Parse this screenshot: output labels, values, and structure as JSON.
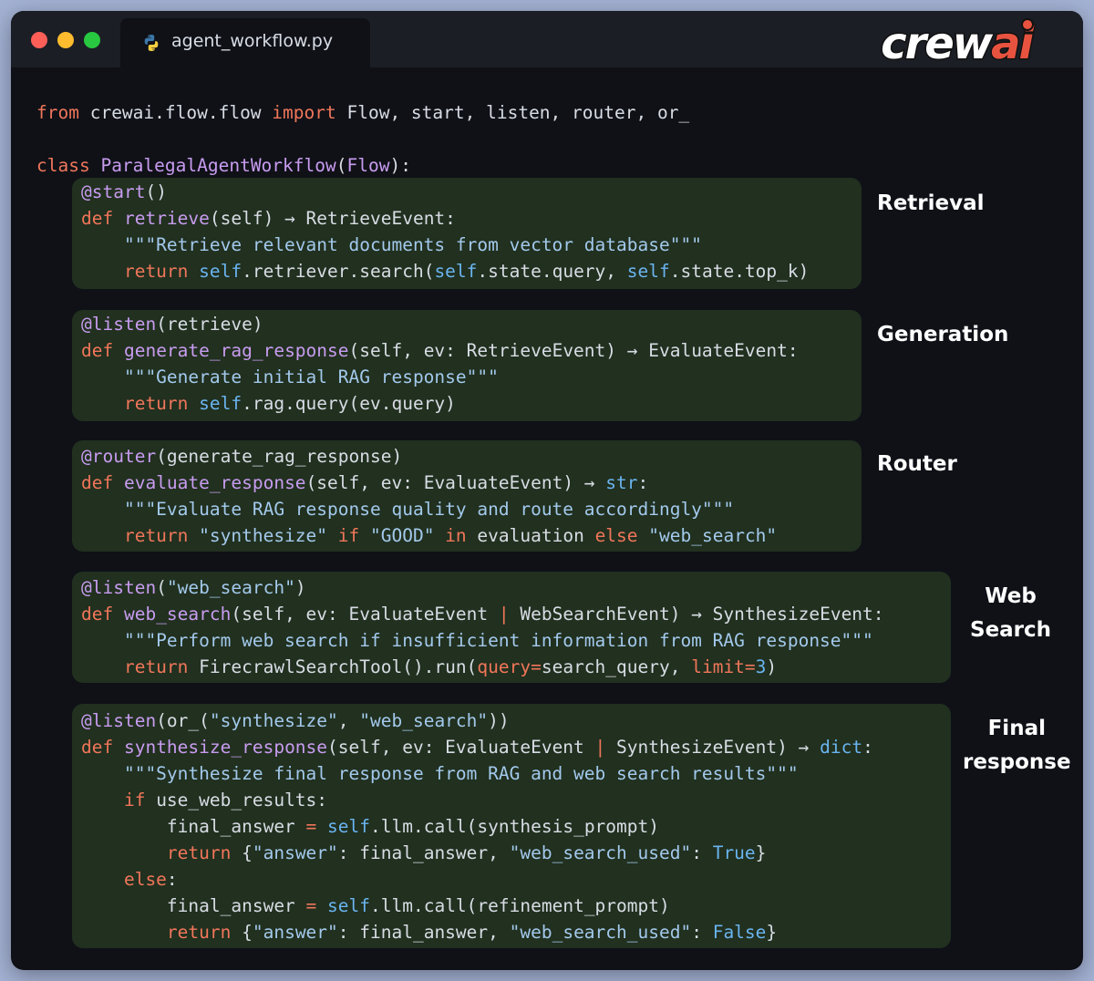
{
  "window": {
    "tab_label": "agent_workflow.py",
    "tab_icon": "python-icon",
    "logo_main": "crew",
    "logo_accent": "ai"
  },
  "colors": {
    "keyword": "#f0765a",
    "function": "#c89cf0",
    "string": "#a3c9ec",
    "self": "#6ab4f0",
    "text": "#d8dce4",
    "block_bg": "#21301f",
    "editor_bg": "#0f1117"
  },
  "code": {
    "import_line": {
      "t1": "from",
      "t2": " crewai.flow.flow ",
      "t3": "import",
      "t4": " Flow, start, listen, router, or_"
    },
    "class_line": {
      "t1": "class ",
      "t2": "ParalegalAgentWorkflow",
      "t3": "(",
      "t4": "Flow",
      "t5": "):"
    },
    "retrieve": {
      "l1": {
        "t1": "@start",
        "t2": "()"
      },
      "l2": {
        "t1": "def ",
        "t2": "retrieve",
        "t3": "(self) → RetrieveEvent:"
      },
      "l3": {
        "t1": "    \"\"\"Retrieve relevant documents from vector database\"\"\""
      },
      "l4": {
        "t1": "    return ",
        "t2": "self",
        ".t3": "",
        "t3": ".retriever.search(",
        "t4": "self",
        "t5": ".state.query, ",
        "t6": "self",
        "t7": ".state.top_k)"
      }
    },
    "generate": {
      "l1": {
        "t1": "@listen",
        "t2": "(retrieve)"
      },
      "l2": {
        "t1": "def ",
        "t2": "generate_rag_response",
        "t3": "(self, ev: RetrieveEvent) → EvaluateEvent:"
      },
      "l3": {
        "t1": "    \"\"\"Generate initial RAG response\"\"\""
      },
      "l4": {
        "t1": "    return ",
        "t2": "self",
        "t3": ".rag.query(ev.query)"
      }
    },
    "router": {
      "l1": {
        "t1": "@router",
        "t2": "(generate_rag_response)"
      },
      "l2": {
        "t1": "def ",
        "t2": "evaluate_response",
        "t3": "(self, ev: EvaluateEvent) → ",
        "t4": "str",
        ".t5": "",
        "t5": ":"
      },
      "l3": {
        "t1": "    \"\"\"Evaluate RAG response quality and route accordingly\"\"\""
      },
      "l4": {
        "t1": "    return ",
        "t2": "\"synthesize\"",
        "t3": " if ",
        "t4": "\"GOOD\"",
        "t5": " in ",
        "t6": "evaluation",
        "t7": " else ",
        "t8": "\"web_search\""
      }
    },
    "web": {
      "l1": {
        "t1": "@listen",
        "t2": "(",
        "t3": "\"web_search\"",
        "t4": ")"
      },
      "l2": {
        "t1": "def ",
        "t2": "web_search",
        "t3": "(self, ev: EvaluateEvent ",
        "t4": "|",
        "t5": " WebSearchEvent) → SynthesizeEvent:"
      },
      "l3": {
        "t1": "    \"\"\"Perform web search if insufficient information from RAG response\"\"\""
      },
      "l4": {
        "t1": "    return ",
        "t2": "FirecrawlSearchTool().run(",
        "t3": "query=",
        "t4": "search_query, ",
        "t5": "limit=",
        "t6": "3",
        "t7": ")"
      }
    },
    "final": {
      "l1": {
        "t1": "@listen",
        "t2": "(or_(",
        "t3": "\"synthesize\"",
        "t4": ", ",
        "t5": "\"web_search\"",
        "t6": "))"
      },
      "l2": {
        "t1": "def ",
        "t2": "synthesize_response",
        "t3": "(self, ev: EvaluateEvent ",
        "t4": "|",
        "t5": " SynthesizeEvent) → ",
        "t6": "dict",
        "t7": ":"
      },
      "l3": {
        "t1": "    \"\"\"Synthesize final response from RAG and web search results\"\"\""
      },
      "l4": {
        "t1": "    if ",
        "t2": "use_web_results:"
      },
      "l5": {
        "t1": "        final_answer ",
        "t2": "=",
        "t3": " ",
        "t4": "self",
        "t5": ".llm.call(synthesis_prompt)"
      },
      "l6": {
        "t1": "        return ",
        "t2": "{",
        "t3": "\"answer\"",
        "t4": ": final_answer, ",
        "t5": "\"web_search_used\"",
        "t6": ": ",
        "t7": "True",
        "t8": "}"
      },
      "l7": {
        "t1": "    else",
        ":t2": "",
        "t2": ":"
      },
      "l8": {
        "t1": "        final_answer ",
        "t2": "=",
        "t3": " ",
        "t4": "self",
        "t5": ".llm.call(refinement_prompt)"
      },
      "l9": {
        "t1": "        return ",
        "t2": "{",
        "t3": "\"answer\"",
        "t4": ": final_answer, ",
        "t5": "\"web_search_used\"",
        "t6": ": ",
        "t7": "False",
        "t8": "}"
      }
    }
  },
  "labels": {
    "retrieval": "Retrieval",
    "generation": "Generation",
    "router": "Router",
    "web_1": "Web",
    "web_2": "Search",
    "final_1": "Final",
    "final_2": "response"
  }
}
